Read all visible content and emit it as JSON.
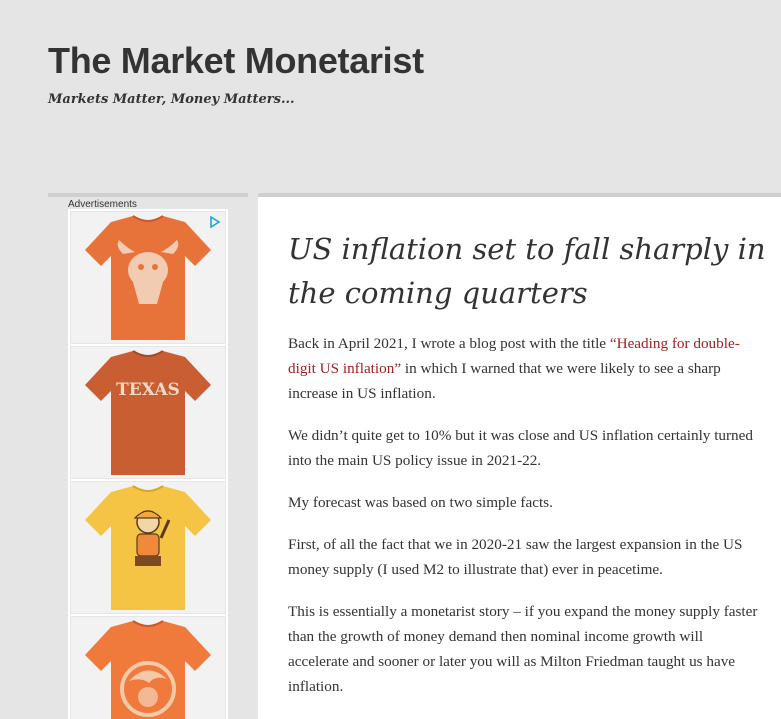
{
  "site": {
    "title": "The Market Monetarist",
    "tagline": "Markets Matter, Money Matters..."
  },
  "sidebar": {
    "ads_label": "Advertisements",
    "ad_choices_icon": "adchoices-triangle-icon",
    "ads": [
      {
        "name": "tshirt-longhorn",
        "color": "#e8733a",
        "graphic": "longhorn"
      },
      {
        "name": "tshirt-texas",
        "color": "#c95e33",
        "text": "TEXAS"
      },
      {
        "name": "tshirt-mascot",
        "color": "#f6c445",
        "graphic": "mascot"
      },
      {
        "name": "tshirt-dolphin",
        "color": "#f07a3c",
        "graphic": "dolphin"
      }
    ]
  },
  "post": {
    "title": "US inflation set to fall sharply in the coming quarters",
    "p1_before": "Back in April 2021, I wrote a blog post with the title ",
    "p1_link": "“Heading for double-digit US inflation”",
    "p1_after": " in which I warned that we were likely to see a sharp increase in US inflation.",
    "p2": "We didn’t quite get to 10% but it was close and US inflation certainly turned into the main US policy issue in 2021-22.",
    "p3": "My forecast was based on two simple facts.",
    "p4": "First, of all the fact that we in 2020-21 saw the largest expansion in the US money supply (I used M2 to illustrate that) ever in peacetime.",
    "p5": "This is essentially a monetarist story – if you expand the money supply faster than the growth of money demand then nominal income growth will accelerate and sooner or later you will as Milton Friedman taught us have inflation."
  },
  "colors": {
    "background": "#e5e5e5",
    "link": "#a02020",
    "text": "#333333"
  }
}
